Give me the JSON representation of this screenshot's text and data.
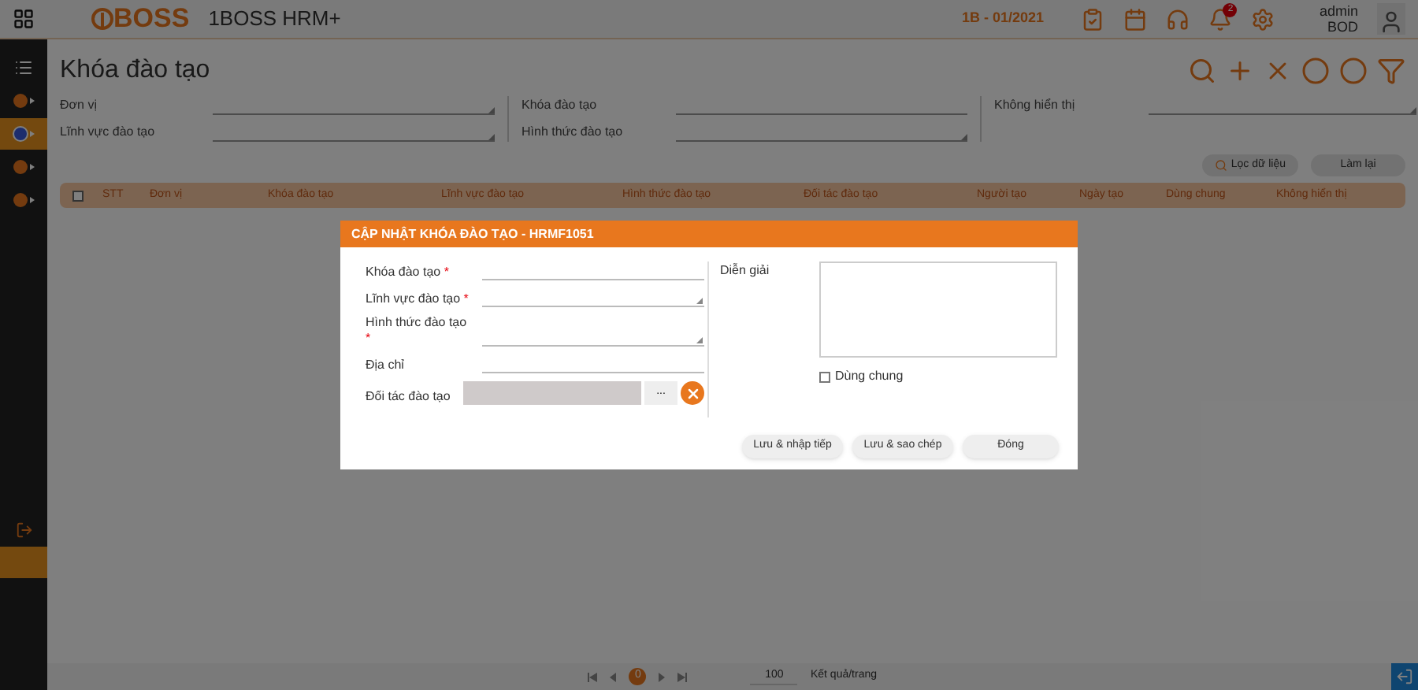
{
  "header": {
    "logo": "BOSS",
    "app_name": "1BOSS HRM+",
    "period": "1B - 01/2021",
    "notification_count": "2",
    "user": "admin",
    "role": "BOD"
  },
  "sidebar": {
    "items": [
      {
        "kind": "menu",
        "selected": false
      },
      {
        "kind": "module",
        "selected": false
      },
      {
        "kind": "module",
        "selected": true
      },
      {
        "kind": "module",
        "selected": false
      },
      {
        "kind": "module",
        "selected": false
      }
    ],
    "bottom_items": [
      {
        "kind": "back",
        "selected": false
      },
      {
        "kind": "blank",
        "selected": true
      }
    ]
  },
  "page": {
    "title": "Khóa đào tạo",
    "filters": [
      {
        "label": "Đơn vị",
        "kind": "select"
      },
      {
        "label": "Lĩnh vực đào tạo",
        "kind": "select"
      },
      {
        "label": "Khóa đào tạo",
        "kind": "text"
      },
      {
        "label": "Hình thức đào tạo",
        "kind": "select"
      },
      {
        "label": "Không hiển thị",
        "kind": "select"
      }
    ],
    "filter_button": "Lọc dữ liệu",
    "reset_button": "Làm lại",
    "table": {
      "select_all_checked": false,
      "columns": [
        "STT",
        "Đơn vị",
        "Khóa đào tạo",
        "Lĩnh vực đào tạo",
        "Hình thức đào tạo",
        "Đối tác đào tạo",
        "Người tạo",
        "Ngày tạo",
        "Dùng chung",
        "Không hiển thị"
      ]
    },
    "pagination": {
      "page": "0",
      "page_size": "100",
      "label": "Kết quả/trang"
    }
  },
  "dialog": {
    "title": "CẬP NHẬT KHÓA ĐÀO TẠO - HRMF1051",
    "fields": [
      {
        "label": "Khóa đào tạo",
        "required": true,
        "kind": "text"
      },
      {
        "label": "Lĩnh vực đào tạo",
        "required": true,
        "kind": "select"
      },
      {
        "label": "Hình thức đào tạo",
        "required": true,
        "kind": "select"
      },
      {
        "label": "Địa chỉ",
        "required": false,
        "kind": "text"
      },
      {
        "label": "Đối tác đào tạo",
        "required": false,
        "kind": "lookup",
        "lookup_button": "..."
      }
    ],
    "required_mark": "*",
    "description_label": "Diễn giải",
    "shared": {
      "label": "Dùng chung",
      "checked": false
    },
    "buttons": [
      "Lưu & nhập tiếp",
      "Lưu & sao chép",
      "Đóng"
    ]
  }
}
